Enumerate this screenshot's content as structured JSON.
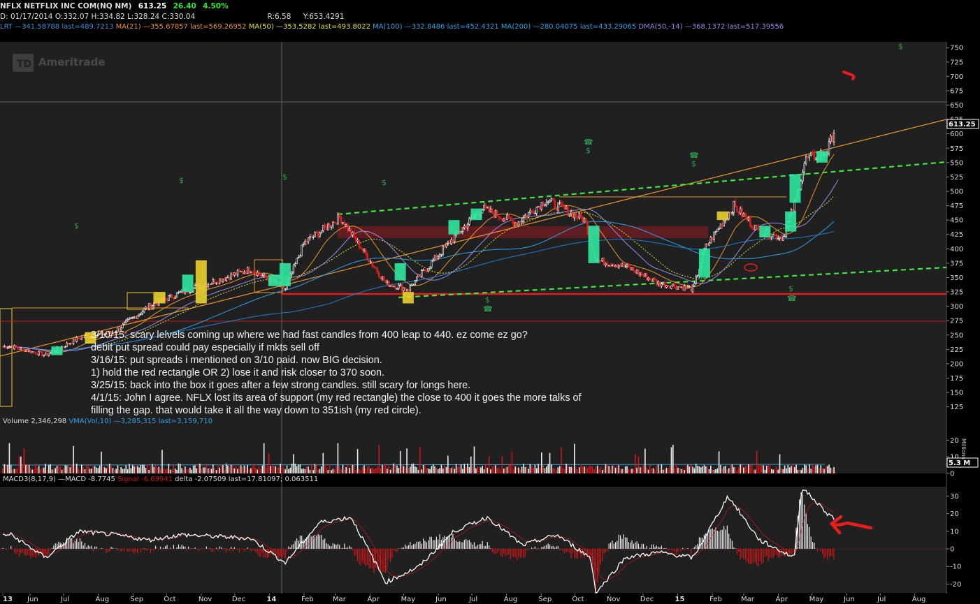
{
  "header": {
    "symbol": "NFLX NETFLIX INC COM(NQ NM)",
    "last": "613.25",
    "change": "26.40",
    "change_pct": "4.50%",
    "date": "D: 01/17/2014",
    "open": "O:332.07",
    "high": "H:334.82",
    "low": "L:328.24",
    "close": "C:330.04",
    "range": "R:6.58",
    "yval": "Y:653.4291",
    "studies": [
      {
        "text": "LRT —341.58788 last=489.7213",
        "color": "#3a8fd8"
      },
      {
        "text": "MA(21) —355.67857 last=569.26952",
        "color": "#e8962e"
      },
      {
        "text": "MA(50) —353.5282 last=493.8022",
        "color": "#e6e62e"
      },
      {
        "text": "MA(100) —332.8486 last=452.4321",
        "color": "#2ea3e8"
      },
      {
        "text": "MA(200) —280.04075 last=433.29065",
        "color": "#2ea3e8"
      },
      {
        "text": "DMA(50,-14) —368.1372 last=517.39556",
        "color": "#9a8ae8"
      }
    ]
  },
  "watermark": "Ameritrade",
  "price_tag": "613.25",
  "notes": [
    "3/10/15: scary lelvels coming up where we had fast candles from 400 leap to 440. ez come ez go?",
    "debit put spread could pay especially if mkts sell off",
    "3/16/15: put spreads i mentioned on 3/10 paid. now BIG decision.",
    "1) hold the red rectangle OR 2) lose it and risk closer to 370 soon.",
    "3/25/15: back into the box it goes after a few strong candles. still scary for longs here.",
    "4/1/15: John I agree. NFLX lost its area of support (my red rectangle) the close to 400 it goes the more talks of",
    "filling the gap. that would take it all the way down to 351ish (my red circle)."
  ],
  "volume_header": {
    "volume": "Volume 2,346,298",
    "vma": "VMA(Vol,10) —3,285,315 last=3,159,710"
  },
  "volume_tag": "5.3 M",
  "volume_unit": "Millions",
  "macd_header": {
    "macd": "MACD3(8,17,9) —MACD -8.7745",
    "signal": "Signal -6.69941",
    "delta": "delta -2.07509 last=17.81097;",
    "rest": "0.063511"
  },
  "chart_data": [
    {
      "type": "candlestick",
      "x_axis": {
        "labels": [
          "13",
          "Jun",
          "Jul",
          "Aug",
          "Sep",
          "Oct",
          "Nov",
          "Dec",
          "14",
          "Feb",
          "Mar",
          "Apr",
          "May",
          "Jun",
          "Jul",
          "Aug",
          "Sep",
          "Oct",
          "Nov",
          "Dec",
          "15",
          "Feb",
          "Mar",
          "Apr",
          "May",
          "Jun",
          "Jul",
          "Aug"
        ]
      },
      "y_axis": {
        "ticks": [
          125,
          150,
          175,
          200,
          225,
          250,
          275,
          300,
          325,
          350,
          375,
          400,
          425,
          450,
          475,
          500,
          525,
          550,
          575,
          600,
          625,
          650,
          675,
          700,
          725,
          750
        ],
        "range": [
          110,
          760
        ]
      },
      "series": [
        {
          "name": "NFLX",
          "points": [
            {
              "x": "2013-05-15",
              "y": 230
            },
            {
              "x": "2013-06-15",
              "y": 215
            },
            {
              "x": "2013-07-15",
              "y": 245
            },
            {
              "x": "2013-08-15",
              "y": 255
            },
            {
              "x": "2013-09-15",
              "y": 300
            },
            {
              "x": "2013-10-15",
              "y": 325
            },
            {
              "x": "2013-11-15",
              "y": 345
            },
            {
              "x": "2013-12-15",
              "y": 365
            },
            {
              "x": "2014-01-15",
              "y": 330
            },
            {
              "x": "2014-02-01",
              "y": 410
            },
            {
              "x": "2014-03-05",
              "y": 455
            },
            {
              "x": "2014-04-15",
              "y": 340
            },
            {
              "x": "2014-05-05",
              "y": 330
            },
            {
              "x": "2014-06-15",
              "y": 420
            },
            {
              "x": "2014-07-10",
              "y": 470
            },
            {
              "x": "2014-08-10",
              "y": 445
            },
            {
              "x": "2014-09-05",
              "y": 485
            },
            {
              "x": "2014-10-10",
              "y": 450
            },
            {
              "x": "2014-10-20",
              "y": 380
            },
            {
              "x": "2014-11-15",
              "y": 370
            },
            {
              "x": "2014-12-15",
              "y": 340
            },
            {
              "x": "2015-01-15",
              "y": 330
            },
            {
              "x": "2015-01-25",
              "y": 400
            },
            {
              "x": "2015-02-20",
              "y": 475
            },
            {
              "x": "2015-03-15",
              "y": 430
            },
            {
              "x": "2015-04-05",
              "y": 420
            },
            {
              "x": "2015-04-16",
              "y": 480
            },
            {
              "x": "2015-04-25",
              "y": 555
            },
            {
              "x": "2015-05-15",
              "y": 570
            },
            {
              "x": "2015-05-22",
              "y": 613
            }
          ]
        }
      ],
      "annotations": [
        "price tag 613.25",
        "red horizontal support 318",
        "red horizontal 270",
        "green dashed channel",
        "orange trendline",
        "red rectangle 415-437"
      ]
    },
    {
      "type": "bar",
      "title": "Volume",
      "y_axis": {
        "ticks": [
          0,
          10,
          20
        ],
        "label": "Millions"
      },
      "last_value": "5.3 M"
    },
    {
      "type": "line",
      "title": "MACD3(8,17,9)",
      "y_axis": {
        "ticks": [
          -20,
          -10,
          0,
          10,
          20,
          30
        ]
      },
      "series": [
        {
          "name": "MACD",
          "points": [
            {
              "x": "2013-05",
              "y": 8
            },
            {
              "x": "2013-06",
              "y": -5
            },
            {
              "x": "2013-07",
              "y": 10
            },
            {
              "x": "2013-08",
              "y": 8
            },
            {
              "x": "2013-09",
              "y": 5
            },
            {
              "x": "2013-10",
              "y": 8
            },
            {
              "x": "2013-11",
              "y": 7
            },
            {
              "x": "2013-12",
              "y": 6
            },
            {
              "x": "2014-01",
              "y": -8
            },
            {
              "x": "2014-02",
              "y": 15
            },
            {
              "x": "2014-03",
              "y": 18
            },
            {
              "x": "2014-04",
              "y": -19
            },
            {
              "x": "2014-05",
              "y": -10
            },
            {
              "x": "2014-06",
              "y": 10
            },
            {
              "x": "2014-07",
              "y": 18
            },
            {
              "x": "2014-08",
              "y": 2
            },
            {
              "x": "2014-09",
              "y": 8
            },
            {
              "x": "2014-10",
              "y": -5
            },
            {
              "x": "2014-10-20",
              "y": -25
            },
            {
              "x": "2014-11",
              "y": -5
            },
            {
              "x": "2014-12",
              "y": -2
            },
            {
              "x": "2015-01",
              "y": -5
            },
            {
              "x": "2015-02",
              "y": 30
            },
            {
              "x": "2015-03",
              "y": 5
            },
            {
              "x": "2015-04",
              "y": -5
            },
            {
              "x": "2015-04-22",
              "y": 35
            },
            {
              "x": "2015-05",
              "y": 20
            },
            {
              "x": "2015-05-22",
              "y": 17
            }
          ]
        }
      ]
    }
  ]
}
